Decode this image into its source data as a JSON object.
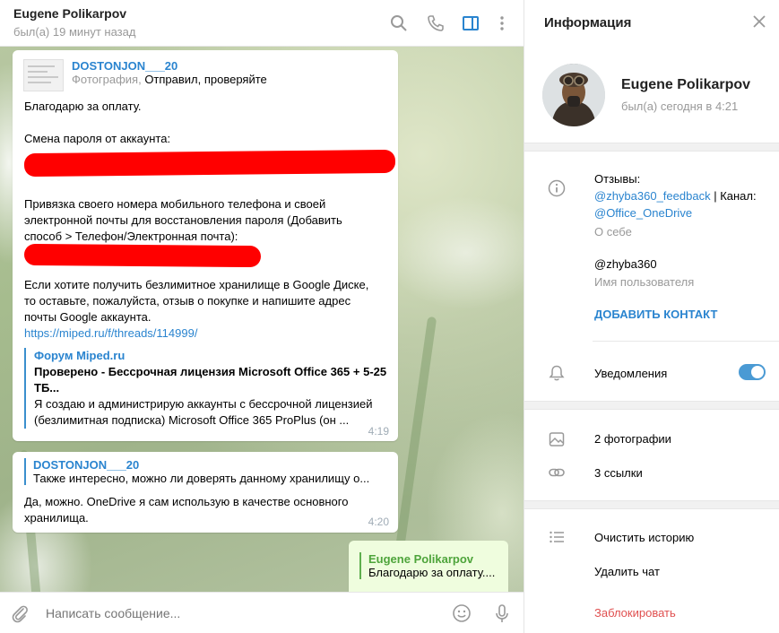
{
  "chat": {
    "title": "Eugene Polikarpov",
    "status": "был(а) 19 минут назад",
    "messages": [
      {
        "reply_name": "DOSTONJON___20",
        "reply_type": "Фотография,",
        "reply_text": "Отправил, проверяйте",
        "line1": "Благодарю за оплату.",
        "line2": "Смена пароля от аккаунта:",
        "line3": "Привязка своего номера мобильного телефона и своей",
        "line4": "электронной почты для восстановления пароля (Добавить",
        "line5": "способ > Телефон/Электронная почта):",
        "line6": "Если хотите получить безлимитное хранилище в Google Диске,",
        "line7": "то оставьте, пожалуйста, отзыв о покупке и напишите адрес",
        "line8": "почты Google аккаунта.",
        "link": "https://miped.ru/f/threads/114999/",
        "preview_site": "Форум Miped.ru",
        "preview_title1": "Проверено - Бессрочная лицензия Microsoft Office 365 + 5-25",
        "preview_title2": "ТБ...",
        "preview_desc1": "Я создаю и администрирую аккаунты с бессрочной лицензией",
        "preview_desc2": "(безлимитная подписка) Microsoft Office 365 ProPlus (он ...",
        "time": "4:19"
      },
      {
        "reply_name": "DOSTONJON___20",
        "reply_text": "Также интересно, можно ли доверять данному хранилищу о...",
        "line1": "Да, можно. OneDrive я сам использую в качестве основного",
        "line2": "хранилища.",
        "time": "4:20"
      },
      {
        "reply_name": "Eugene Polikarpov",
        "reply_text": "Благодарю за оплату...."
      }
    ],
    "composer_placeholder": "Написать сообщение..."
  },
  "info": {
    "title": "Информация",
    "name": "Eugene Polikarpov",
    "status": "был(а) сегодня в 4:21",
    "bio_line1": "Отзывы:",
    "bio_link1": "@zhyba360_feedback",
    "bio_sep": "| Канал:",
    "bio_link2": "@Office_OneDrive",
    "bio_label": "О себе",
    "username": "@zhyba360",
    "username_label": "Имя пользователя",
    "add_contact": "ДОБАВИТЬ КОНТАКТ",
    "notifications": "Уведомления",
    "notifications_on": true,
    "photos": "2 фотографии",
    "links": "3 ссылки",
    "clear_history": "Очистить историю",
    "delete_chat": "Удалить чат",
    "block": "Заблокировать"
  },
  "colors": {
    "accent": "#2a84cf",
    "outgoing_bubble": "#effdde",
    "redaction": "#ff0000",
    "danger": "#e05050"
  }
}
